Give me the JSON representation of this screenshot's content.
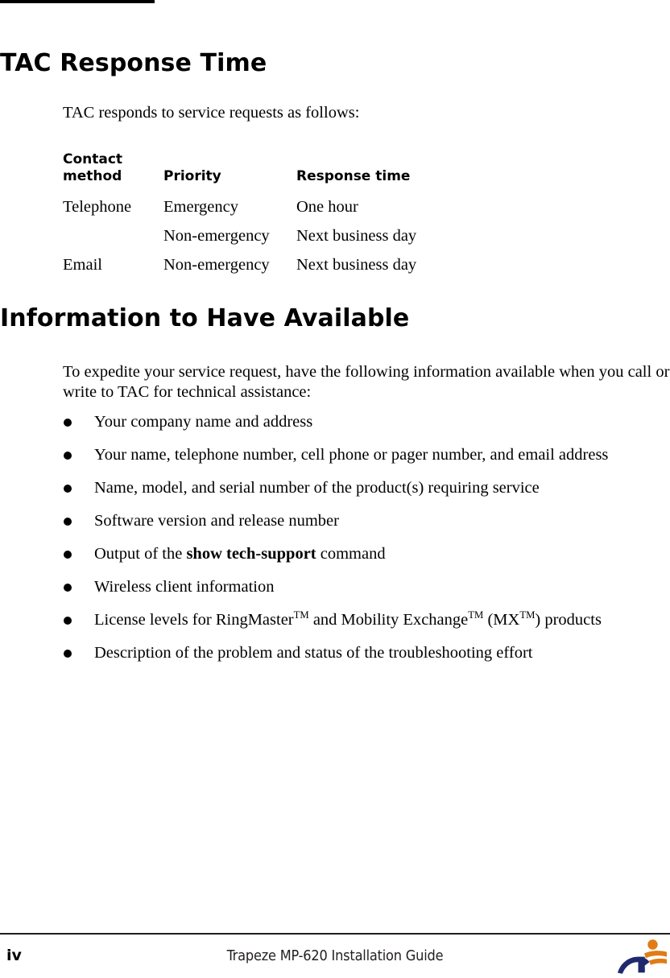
{
  "page": {
    "top_rule": "header-rule",
    "background_color": "#ffffff",
    "text_color": "#000000"
  },
  "sections": [
    {
      "heading": "TAC Response Time",
      "intro": "TAC responds to service requests as follows:"
    },
    {
      "heading": "Information to Have Available",
      "intro": "To expedite your service request, have the following information available when you call or write to TAC for technical assistance:"
    }
  ],
  "table": {
    "headers": [
      "Contact method",
      "Priority",
      "Response time"
    ],
    "header_lines": {
      "col1_line1": "Contact",
      "col1_line2": "method",
      "col2": "Priority",
      "col3": "Response time"
    },
    "rows": [
      [
        "Telephone",
        "Emergency",
        "One hour"
      ],
      [
        "",
        "Non-emergency",
        "Next business day"
      ],
      [
        "Email",
        "Non-emergency",
        "Next business day"
      ]
    ]
  },
  "bullets": [
    {
      "text": "Your company name and address"
    },
    {
      "text": "Your name, telephone number, cell phone or pager number, and email address"
    },
    {
      "text": "Name, model, and serial number of the product(s) requiring service"
    },
    {
      "text": "Software version and release number"
    },
    {
      "prefix": "Output of the ",
      "bold": "show tech-support",
      "suffix": " command"
    },
    {
      "text": "Wireless client information"
    },
    {
      "segments": [
        "License levels for RingMaster",
        "TM",
        " and Mobility Exchange",
        "TM",
        " (MX",
        "TM",
        ") products"
      ]
    },
    {
      "text": "Description of the problem and status of the troubleshooting effort"
    }
  ],
  "footer": {
    "page_number": "iv",
    "document_title": "Trapeze MP-620 Installation Guide",
    "logo": {
      "name": "trapeze-networks-logo",
      "colors": {
        "orange": "#E07B16",
        "navy": "#1F2A6E"
      }
    }
  }
}
